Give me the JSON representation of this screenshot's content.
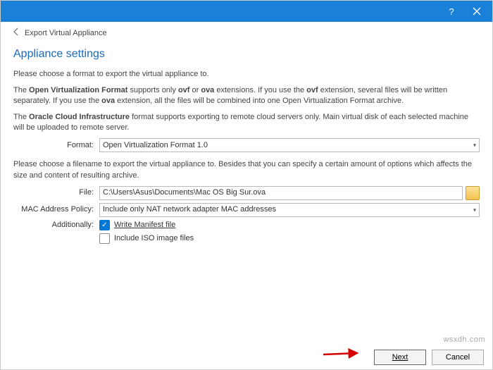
{
  "titlebar": {
    "help": "?",
    "close": "×"
  },
  "breadcrumb": {
    "title": "Export Virtual Appliance"
  },
  "section": {
    "title": "Appliance settings"
  },
  "paragraphs": {
    "intro": "Please choose a format to export the virtual appliance to.",
    "ovf_a": "The ",
    "ovf_b": "Open Virtualization Format",
    "ovf_c": " supports only ",
    "ovf_d": "ovf",
    "ovf_e": " or ",
    "ovf_f": "ova",
    "ovf_g": " extensions. If you use the ",
    "ovf_h": "ovf",
    "ovf_i": " extension, several files will be written separately. If you use the ",
    "ovf_j": "ova",
    "ovf_k": " extension, all the files will be combined into one Open Virtualization Format archive.",
    "oci_a": "The ",
    "oci_b": "Oracle Cloud Infrastructure",
    "oci_c": " format supports exporting to remote cloud servers only. Main virtual disk of each selected machine will be uploaded to remote server.",
    "file_hint": "Please choose a filename to export the virtual appliance to. Besides that you can specify a certain amount of options which affects the size and content of resulting archive."
  },
  "form": {
    "format_label": "Format:",
    "format_value": "Open Virtualization Format 1.0",
    "file_label": "File:",
    "file_value": "C:\\Users\\Asus\\Documents\\Mac OS Big Sur.ova",
    "mac_label": "MAC Address Policy:",
    "mac_value": "Include only NAT network adapter MAC addresses",
    "additionally_label": "Additionally:",
    "manifest_label": "Write Manifest file",
    "iso_label": "Include ISO image files"
  },
  "footer": {
    "next": "Next",
    "cancel": "Cancel"
  },
  "watermark": "wsxdh.com"
}
